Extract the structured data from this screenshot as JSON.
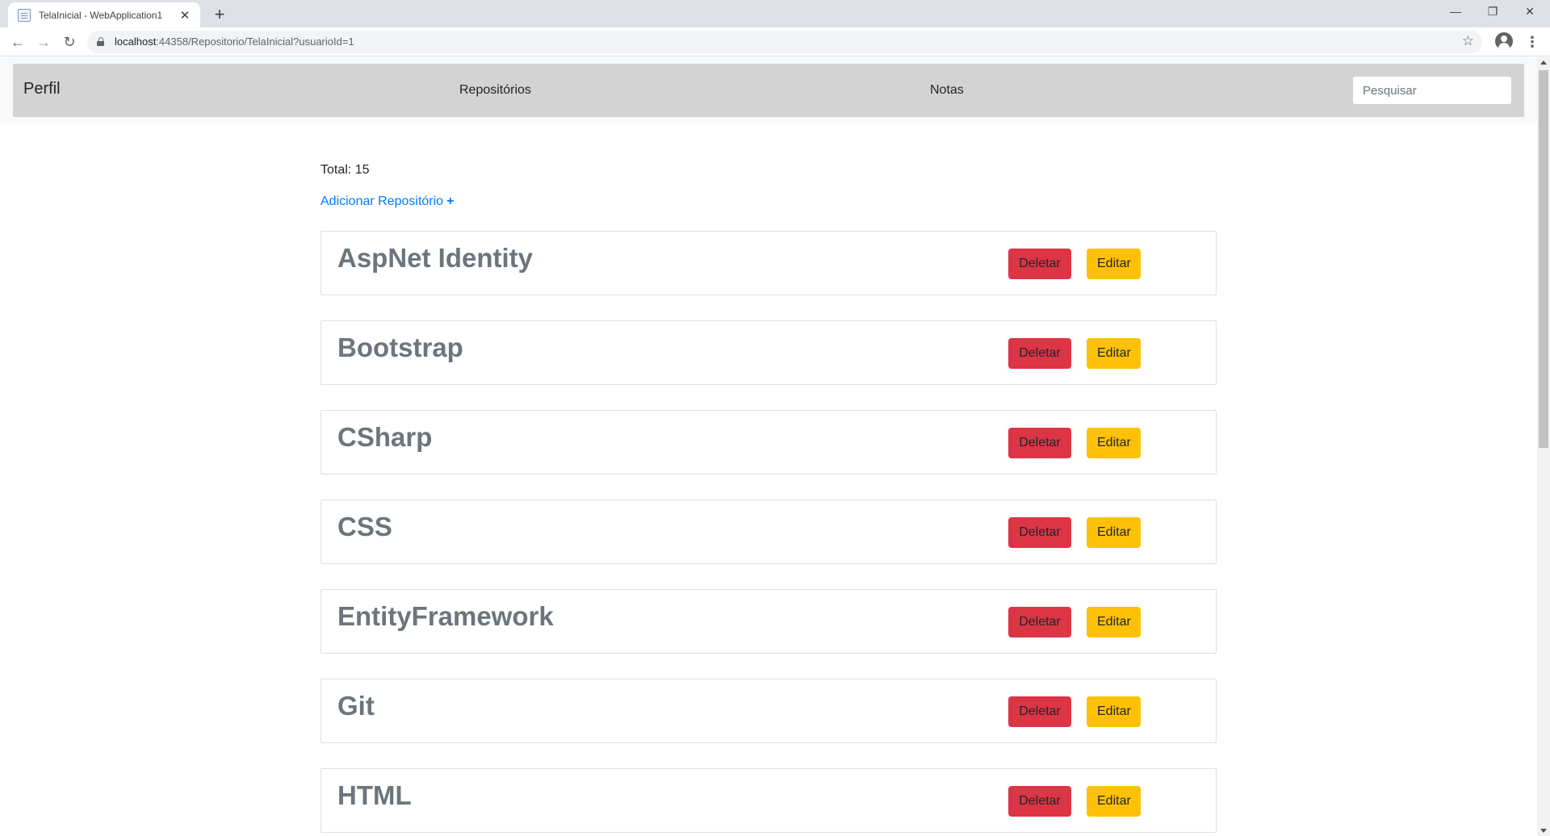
{
  "browser": {
    "tab_title": "TelaInicial - WebApplication1",
    "tab_close": "✕",
    "new_tab": "+",
    "window": {
      "minimize": "—",
      "maximize": "❐",
      "close": "✕"
    },
    "back": "←",
    "forward": "→",
    "reload": "↻",
    "url_host": "localhost",
    "url_rest": ":44358/Repositorio/TelaInicial?usuarioId=1",
    "bookmark": "☆",
    "menu": "⋮"
  },
  "navbar": {
    "brand": "Perfil",
    "links": [
      "Repositórios",
      "Notas"
    ],
    "search_placeholder": "Pesquisar"
  },
  "main": {
    "total": "Total: 15",
    "add_label": "Adicionar Repositório",
    "add_plus": "+",
    "delete_label": "Deletar",
    "edit_label": "Editar",
    "repositories": [
      "AspNet Identity",
      "Bootstrap",
      "CSharp",
      "CSS",
      "EntityFramework",
      "Git",
      "HTML"
    ]
  },
  "colors": {
    "danger": "#dc3545",
    "warning": "#ffc107",
    "link": "#007bff",
    "navbar_bg": "#d3d3d3"
  }
}
